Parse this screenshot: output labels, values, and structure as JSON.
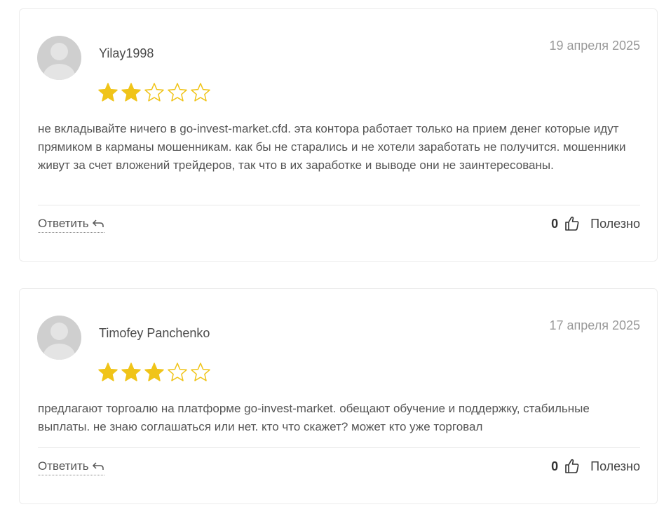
{
  "reviews": [
    {
      "author": "Yilay1998",
      "date": "19 апреля 2025",
      "rating": 2,
      "max_rating": 5,
      "text": "не вкладывайте ничего в go-invest-market.cfd. эта контора работает только на прием денег которые идут прямиком в карманы мошенникам. как бы не старались и не хотели заработать не получится. мошенники живут за счет вложений трейдеров, так что в их заработке и выводе они не заинтересованы.",
      "reply_label": "Ответить",
      "helpful_count": "0",
      "helpful_label": "Полезно"
    },
    {
      "author": "Timofey Panchenko",
      "date": "17 апреля 2025",
      "rating": 3,
      "max_rating": 5,
      "text": "предлагают торгоалю на платформе go-invest-market. обещают обучение и поддержку, стабильные выплаты. не знаю соглашаться или нет. кто что скажет? может кто уже торговал",
      "reply_label": "Ответить",
      "helpful_count": "0",
      "helpful_label": "Полезно"
    }
  ],
  "colors": {
    "star_filled": "#f0c419",
    "star_empty_stroke": "#f0c419",
    "date": "#9a9a9a",
    "avatar_bg": "#cfcfcf"
  },
  "icons": {
    "avatar": "avatar-placeholder-icon",
    "star": "star-icon",
    "reply": "reply-arrow-icon",
    "like": "thumbs-up-icon"
  }
}
